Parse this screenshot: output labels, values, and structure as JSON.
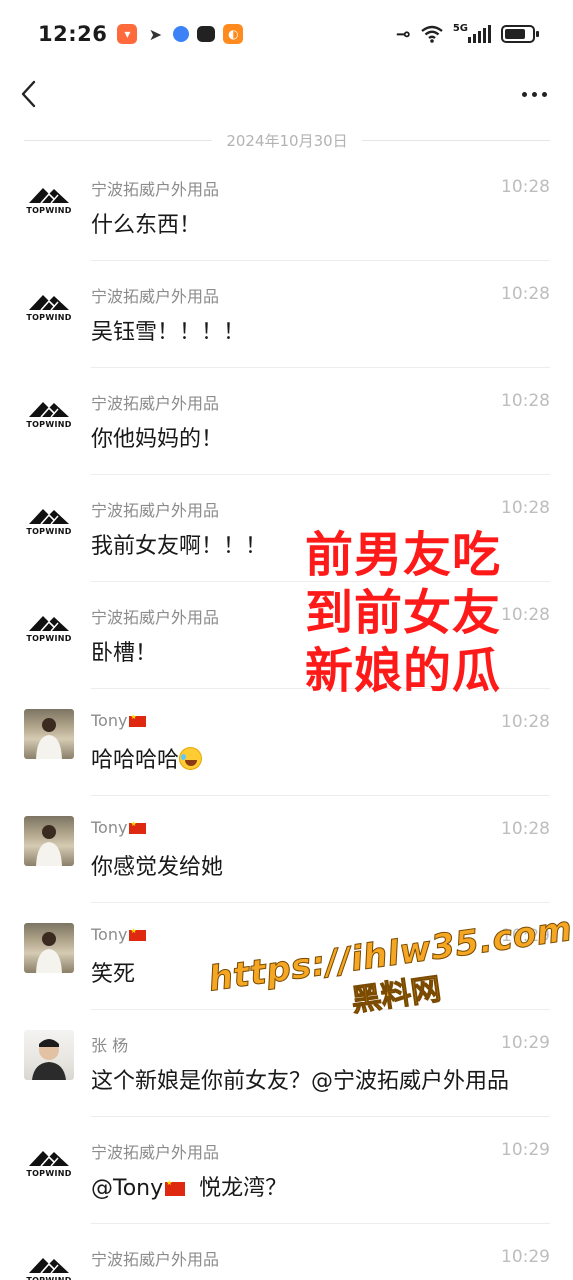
{
  "status_bar": {
    "time": "12:26",
    "network": "5G"
  },
  "date_separator": "2024年10月30日",
  "messages": [
    {
      "sender": "宁波拓威户外用品",
      "avatar": "topwind",
      "time": "10:28",
      "text": "什么东西！"
    },
    {
      "sender": "宁波拓威户外用品",
      "avatar": "topwind",
      "time": "10:28",
      "text": "吴钰雪！！！！"
    },
    {
      "sender": "宁波拓威户外用品",
      "avatar": "topwind",
      "time": "10:28",
      "text": "你他妈妈的！"
    },
    {
      "sender": "宁波拓威户外用品",
      "avatar": "topwind",
      "time": "10:28",
      "text": "我前女友啊！！！"
    },
    {
      "sender": "宁波拓威户外用品",
      "avatar": "topwind",
      "time": "10:28",
      "text": "卧槽！"
    },
    {
      "sender": "Tony",
      "avatar": "tony",
      "time": "10:28",
      "text": "哈哈哈哈"
    },
    {
      "sender": "Tony",
      "avatar": "tony",
      "time": "10:28",
      "text": "你感觉发给她"
    },
    {
      "sender": "Tony",
      "avatar": "tony",
      "time": "10:29",
      "text": "笑死"
    },
    {
      "sender": "张 杨",
      "avatar": "zhang",
      "time": "10:29",
      "text": "这个新娘是你前女友？@宁波拓威户外用品"
    },
    {
      "sender": "宁波拓威户外用品",
      "avatar": "topwind",
      "time": "10:29",
      "text": "@Tony",
      "text_suffix": "  悦龙湾？"
    },
    {
      "sender": "宁波拓威户外用品",
      "avatar": "topwind",
      "time": "10:29",
      "text": ""
    }
  ],
  "logo_text": "TOPWIND",
  "overlay_caption": [
    "前男友吃",
    "到前女友",
    "新娘的瓜"
  ],
  "watermark": {
    "url": "https://ihlw35.com",
    "name": "黑料网"
  },
  "colors": {
    "caption": "#ff1a1a",
    "watermark": "#f5a623"
  }
}
